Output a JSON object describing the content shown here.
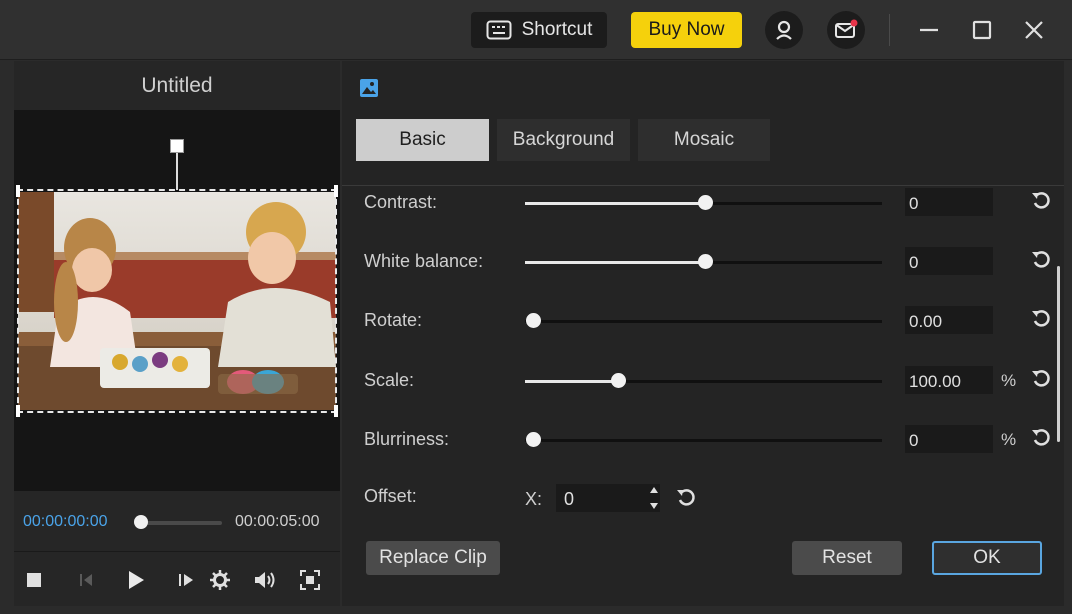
{
  "titlebar": {
    "shortcut_label": "Shortcut",
    "buy_now_label": "Buy Now",
    "accent_color": "#f5d10c"
  },
  "left": {
    "title": "Untitled",
    "time_start": "00:00:00:00",
    "time_end": "00:00:05:00",
    "seek_progress": 0.0
  },
  "tabs": [
    "Basic",
    "Background",
    "Mosaic"
  ],
  "active_tab": "Basic",
  "settings": {
    "contrast": {
      "label": "Contrast:",
      "value": "0",
      "slider_fraction": 0.5
    },
    "white_balance": {
      "label": "White balance:",
      "value": "0",
      "slider_fraction": 0.5
    },
    "rotate": {
      "label": "Rotate:",
      "value": "0.00",
      "slider_fraction": 0.0
    },
    "scale": {
      "label": "Scale:",
      "value": "100.00",
      "unit": "%",
      "slider_fraction": 0.25
    },
    "blurriness": {
      "label": "Blurriness:",
      "value": "0",
      "unit": "%",
      "slider_fraction": 0.0
    },
    "offset": {
      "label": "Offset:",
      "x_label": "X:",
      "x_value": "0"
    }
  },
  "buttons": {
    "replace_clip": "Replace Clip",
    "reset": "Reset",
    "ok": "OK"
  },
  "icons": {
    "shortcut": "keyboard-icon",
    "account": "user-icon",
    "mail": "mail-icon",
    "minimize": "minimize-icon",
    "maximize": "maximize-icon",
    "close": "close-icon"
  }
}
